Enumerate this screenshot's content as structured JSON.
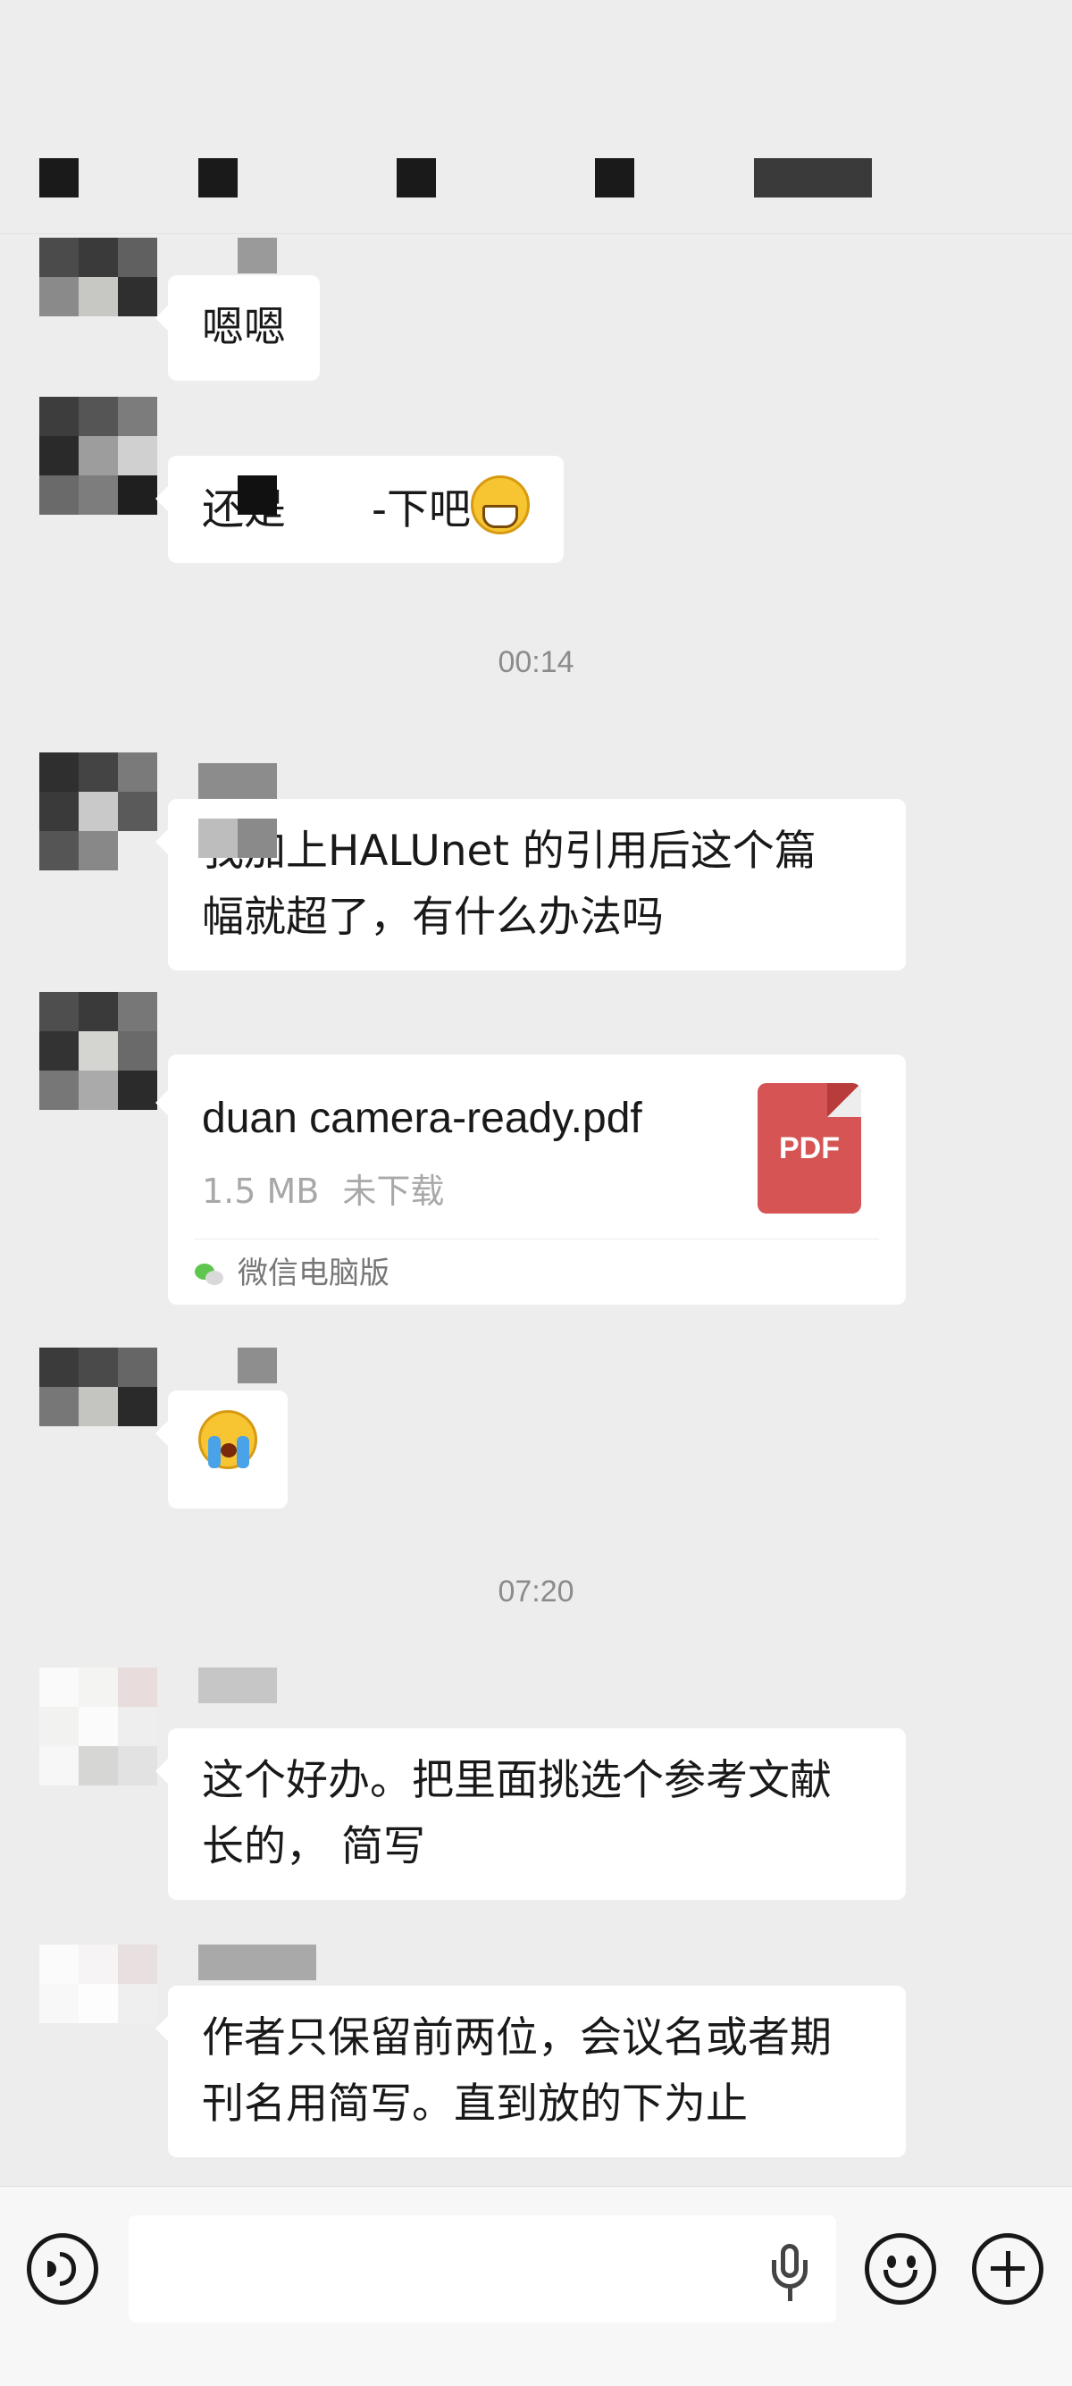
{
  "header": {
    "title_redacted": true
  },
  "messages": [
    {
      "type": "text",
      "text": "嗯嗯"
    },
    {
      "type": "text",
      "text_before": "还是",
      "text_after": "-下吧"
    },
    {
      "type": "time",
      "text": "00:14"
    },
    {
      "type": "text",
      "line1": "我加上HALUnet 的引用后这个篇",
      "line2": "幅就超了，有什么办法吗"
    },
    {
      "type": "file",
      "file_name": "duan camera-ready.pdf",
      "file_size": "1.5 MB",
      "file_status": "未下载",
      "file_badge": "PDF",
      "source": "微信电脑版"
    },
    {
      "type": "emoji",
      "emoji": "loudly-crying-face"
    },
    {
      "type": "time",
      "text": "07:20"
    },
    {
      "type": "text",
      "line1": "这个好办。把里面挑选个参考文献",
      "line2": "长的， 简写"
    },
    {
      "type": "text",
      "line1": "作者只保留前两位，会议名或者期",
      "line2": "刊名用简写。直到放的下为止"
    }
  ],
  "input_bar": {
    "placeholder": "",
    "icons": [
      "voice-icon",
      "microphone-icon",
      "emoji-icon",
      "plus-icon"
    ]
  },
  "colors": {
    "background": "#ededed",
    "bubble": "#ffffff",
    "timestamp": "#8c8c8c",
    "pdf": "#d65454"
  }
}
